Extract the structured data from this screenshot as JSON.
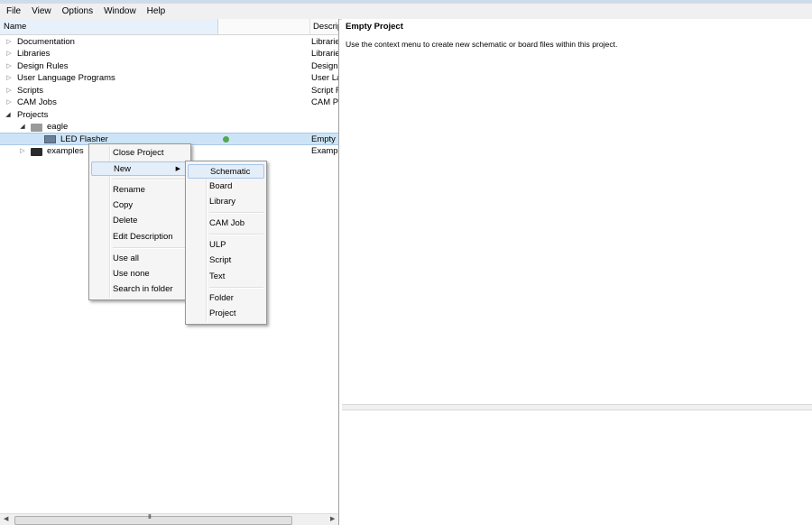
{
  "menubar": [
    "File",
    "View",
    "Options",
    "Window",
    "Help"
  ],
  "tree": {
    "columns": {
      "name": "Name",
      "description": "Descrip"
    },
    "sort_arrow": "^",
    "rows": [
      {
        "label": "Documentation",
        "desc": "Librarie"
      },
      {
        "label": "Libraries",
        "desc": "Librarie"
      },
      {
        "label": "Design Rules",
        "desc": "Design"
      },
      {
        "label": "User Language Programs",
        "desc": "User La"
      },
      {
        "label": "Scripts",
        "desc": "Script F"
      },
      {
        "label": "CAM Jobs",
        "desc": "CAM P"
      },
      {
        "label": "Projects",
        "desc": ""
      },
      {
        "label": "eagle",
        "desc": ""
      },
      {
        "label": "LED Flasher",
        "desc": "Empty"
      },
      {
        "label": "examples",
        "desc": "Exampl"
      }
    ],
    "rows_desc_fix": [
      "",
      "Librarie",
      "Design",
      "User La",
      "Script F",
      "CAM P"
    ]
  },
  "detail": {
    "title": "Empty Project",
    "text": "Use the context menu to create new schematic or board files within this project."
  },
  "context_menu": {
    "items": [
      "Close Project",
      "New",
      "Rename",
      "Copy",
      "Delete",
      "Edit Description",
      "Use all",
      "Use none",
      "Search in folder"
    ]
  },
  "submenu": {
    "items": [
      "Schematic",
      "Board",
      "Library",
      "CAM Job",
      "ULP",
      "Script",
      "Text",
      "Folder",
      "Project"
    ]
  },
  "colors": {
    "selection": "#cde4f7",
    "status_dot": "#52a852",
    "menu_highlight": "#e4eef9"
  },
  "scroll": {
    "grip": "III"
  }
}
